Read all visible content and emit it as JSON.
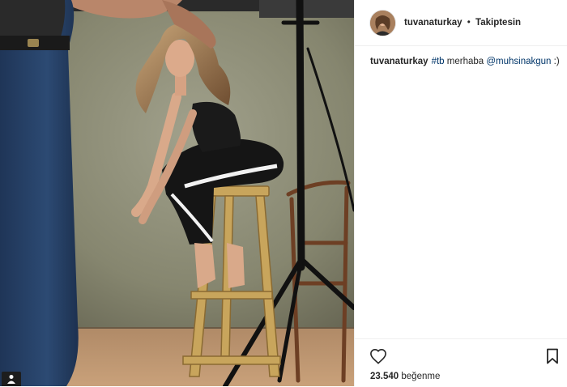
{
  "post": {
    "username": "tuvanaturkay",
    "separator": "•",
    "follow_state": "Takiptesin",
    "caption": {
      "username": "tuvanaturkay",
      "hashtag": "#tb",
      "text": " merhaba ",
      "mention": "@muhsinakgun",
      "suffix": " :)"
    },
    "likes": {
      "count": "23.540",
      "label": "beğenme"
    },
    "icons": {
      "like": "heart-outline-icon",
      "save": "bookmark-outline-icon",
      "media": "gallery-icon"
    },
    "colors": {
      "text": "#262626",
      "link": "#003569",
      "divider": "#efefef"
    }
  }
}
